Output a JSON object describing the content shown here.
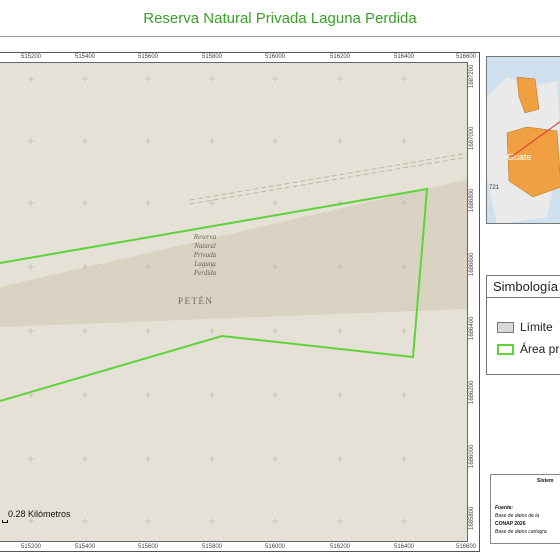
{
  "map": {
    "title": "Reserva Natural Privada Laguna Perdida",
    "area_label": "Reserva Natural Privada Laguna Perdida",
    "area_label_lines": [
      "Reserva",
      "Natural",
      "Privada",
      "Laguna",
      "Perdida"
    ],
    "region_label": "PETÉN",
    "scale_text": "0.28 Kilómetros",
    "x_ticks": [
      "515200",
      "515400",
      "515600",
      "515800",
      "516000",
      "516200",
      "516400",
      "516600"
    ],
    "y_ticks": [
      "1687200",
      "1687000",
      "1686800",
      "1686600",
      "1686400",
      "1686200",
      "1686000",
      "1685800"
    ],
    "colors": {
      "title": "#3aa02a",
      "boundary": "#5ed43a",
      "basemap": "#e6e1d6",
      "protected_fill": "#d9d2c2",
      "inset_country": "#f0a040",
      "inset_water": "#cfe0ef",
      "inset_line": "#e03030"
    }
  },
  "inset": {
    "country_label": "Guate",
    "road_label": "721"
  },
  "legend": {
    "title": "Simbología",
    "items": [
      {
        "label": "Límite",
        "swatch": "#d9d9d9",
        "border": "#7a7a7a"
      },
      {
        "label": "Área pr",
        "swatch": "#ffffff",
        "border": "#5ed43a"
      }
    ]
  },
  "source": {
    "heading": "Sistem",
    "fuente": "Fuente:",
    "line1": "Base de datos de la",
    "line2": "CONAP 2026",
    "line3": "Base de datos cartogra"
  }
}
